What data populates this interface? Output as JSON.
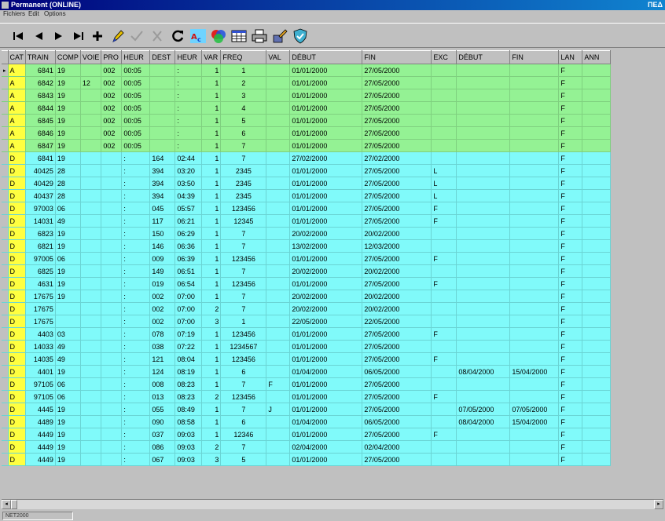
{
  "window": {
    "title": "Permanent (ONLINE)",
    "corner": "ΠΕΔ"
  },
  "menu": [
    {
      "id": "fichiers",
      "label": "Fichiers"
    },
    {
      "id": "edit",
      "label": "Edit"
    },
    {
      "id": "options",
      "label": "Options"
    }
  ],
  "toolbar": [
    {
      "name": "first-record-icon",
      "enabled": true
    },
    {
      "name": "previous-record-icon",
      "enabled": true
    },
    {
      "name": "next-record-icon",
      "enabled": true
    },
    {
      "name": "last-record-icon",
      "enabled": true
    },
    {
      "name": "add-record-icon",
      "enabled": true
    },
    {
      "name": "edit-pencil-icon",
      "enabled": true
    },
    {
      "name": "confirm-check-icon",
      "enabled": false
    },
    {
      "name": "cancel-x-icon",
      "enabled": false
    },
    {
      "name": "refresh-icon",
      "enabled": true
    },
    {
      "name": "spellcheck-abc-icon",
      "enabled": true
    },
    {
      "name": "color-palette-icon",
      "enabled": true
    },
    {
      "name": "grid-table-icon",
      "enabled": true
    },
    {
      "name": "print-icon",
      "enabled": true
    },
    {
      "name": "brush-icon",
      "enabled": true
    },
    {
      "name": "shield-icon",
      "enabled": true
    }
  ],
  "columns": [
    "CAT",
    "TRAIN",
    "COMP",
    "VOIE",
    "PRO",
    "HEUR",
    "DEST",
    "HEUR",
    "VAR",
    "FREQ",
    "VAL",
    "DÉBUT",
    "FIN",
    "EXC",
    "DÉBUT",
    "FIN",
    "LAN",
    "ANN"
  ],
  "current_row_marker": "▸",
  "colors": {
    "green_row": "#94f294",
    "cyan_row": "#80fafa",
    "cat_cell": "#ffff40",
    "title_bar": "#00007b"
  },
  "rows": [
    [
      "A",
      "6841",
      "19",
      "",
      "002",
      "00:05",
      "",
      ":",
      "1",
      "1",
      "",
      "01/01/2000",
      "27/05/2000",
      "",
      "",
      "",
      "F",
      ""
    ],
    [
      "A",
      "6842",
      "19",
      "12",
      "002",
      "00:05",
      "",
      ":",
      "1",
      "2",
      "",
      "01/01/2000",
      "27/05/2000",
      "",
      "",
      "",
      "F",
      ""
    ],
    [
      "A",
      "6843",
      "19",
      "",
      "002",
      "00:05",
      "",
      ":",
      "1",
      "3",
      "",
      "01/01/2000",
      "27/05/2000",
      "",
      "",
      "",
      "F",
      ""
    ],
    [
      "A",
      "6844",
      "19",
      "",
      "002",
      "00:05",
      "",
      ":",
      "1",
      "4",
      "",
      "01/01/2000",
      "27/05/2000",
      "",
      "",
      "",
      "F",
      ""
    ],
    [
      "A",
      "6845",
      "19",
      "",
      "002",
      "00:05",
      "",
      ":",
      "1",
      "5",
      "",
      "01/01/2000",
      "27/05/2000",
      "",
      "",
      "",
      "F",
      ""
    ],
    [
      "A",
      "6846",
      "19",
      "",
      "002",
      "00:05",
      "",
      ":",
      "1",
      "6",
      "",
      "01/01/2000",
      "27/05/2000",
      "",
      "",
      "",
      "F",
      ""
    ],
    [
      "A",
      "6847",
      "19",
      "",
      "002",
      "00:05",
      "",
      ":",
      "1",
      "7",
      "",
      "01/01/2000",
      "27/05/2000",
      "",
      "",
      "",
      "F",
      ""
    ],
    [
      "D",
      "6841",
      "19",
      "",
      "",
      ":",
      "164",
      "02:44",
      "1",
      "7",
      "",
      "27/02/2000",
      "27/02/2000",
      "",
      "",
      "",
      "F",
      ""
    ],
    [
      "D",
      "40425",
      "28",
      "",
      "",
      ":",
      "394",
      "03:20",
      "1",
      "2345",
      "",
      "01/01/2000",
      "27/05/2000",
      "L",
      "",
      "",
      "F",
      ""
    ],
    [
      "D",
      "40429",
      "28",
      "",
      "",
      ":",
      "394",
      "03:50",
      "1",
      "2345",
      "",
      "01/01/2000",
      "27/05/2000",
      "L",
      "",
      "",
      "F",
      ""
    ],
    [
      "D",
      "40437",
      "28",
      "",
      "",
      ":",
      "394",
      "04:39",
      "1",
      "2345",
      "",
      "01/01/2000",
      "27/05/2000",
      "L",
      "",
      "",
      "F",
      ""
    ],
    [
      "D",
      "97003",
      "06",
      "",
      "",
      ":",
      "045",
      "05:57",
      "1",
      "123456",
      "",
      "01/01/2000",
      "27/05/2000",
      "F",
      "",
      "",
      "F",
      ""
    ],
    [
      "D",
      "14031",
      "49",
      "",
      "",
      ":",
      "117",
      "06:21",
      "1",
      "12345",
      "",
      "01/01/2000",
      "27/05/2000",
      "F",
      "",
      "",
      "F",
      ""
    ],
    [
      "D",
      "6823",
      "19",
      "",
      "",
      ":",
      "150",
      "06:29",
      "1",
      "7",
      "",
      "20/02/2000",
      "20/02/2000",
      "",
      "",
      "",
      "F",
      ""
    ],
    [
      "D",
      "6821",
      "19",
      "",
      "",
      ":",
      "146",
      "06:36",
      "1",
      "7",
      "",
      "13/02/2000",
      "12/03/2000",
      "",
      "",
      "",
      "F",
      ""
    ],
    [
      "D",
      "97005",
      "06",
      "",
      "",
      ":",
      "009",
      "06:39",
      "1",
      "123456",
      "",
      "01/01/2000",
      "27/05/2000",
      "F",
      "",
      "",
      "F",
      ""
    ],
    [
      "D",
      "6825",
      "19",
      "",
      "",
      ":",
      "149",
      "06:51",
      "1",
      "7",
      "",
      "20/02/2000",
      "20/02/2000",
      "",
      "",
      "",
      "F",
      ""
    ],
    [
      "D",
      "4631",
      "19",
      "",
      "",
      ":",
      "019",
      "06:54",
      "1",
      "123456",
      "",
      "01/01/2000",
      "27/05/2000",
      "F",
      "",
      "",
      "F",
      ""
    ],
    [
      "D",
      "17675",
      "19",
      "",
      "",
      ":",
      "002",
      "07:00",
      "1",
      "7",
      "",
      "20/02/2000",
      "20/02/2000",
      "",
      "",
      "",
      "F",
      ""
    ],
    [
      "D",
      "17675",
      "",
      "",
      "",
      ":",
      "002",
      "07:00",
      "2",
      "7",
      "",
      "20/02/2000",
      "20/02/2000",
      "",
      "",
      "",
      "F",
      ""
    ],
    [
      "D",
      "17675",
      "",
      "",
      "",
      ":",
      "002",
      "07:00",
      "3",
      "1",
      "",
      "22/05/2000",
      "22/05/2000",
      "",
      "",
      "",
      "F",
      ""
    ],
    [
      "D",
      "4403",
      "03",
      "",
      "",
      ":",
      "078",
      "07:19",
      "1",
      "123456",
      "",
      "01/01/2000",
      "27/05/2000",
      "F",
      "",
      "",
      "F",
      ""
    ],
    [
      "D",
      "14033",
      "49",
      "",
      "",
      ":",
      "038",
      "07:22",
      "1",
      "1234567",
      "",
      "01/01/2000",
      "27/05/2000",
      "",
      "",
      "",
      "F",
      ""
    ],
    [
      "D",
      "14035",
      "49",
      "",
      "",
      ":",
      "121",
      "08:04",
      "1",
      "123456",
      "",
      "01/01/2000",
      "27/05/2000",
      "F",
      "",
      "",
      "F",
      ""
    ],
    [
      "D",
      "4401",
      "19",
      "",
      "",
      ":",
      "124",
      "08:19",
      "1",
      "6",
      "",
      "01/04/2000",
      "06/05/2000",
      "",
      "08/04/2000",
      "15/04/2000",
      "F",
      ""
    ],
    [
      "D",
      "97105",
      "06",
      "",
      "",
      ":",
      "008",
      "08:23",
      "1",
      "7",
      "F",
      "01/01/2000",
      "27/05/2000",
      "",
      "",
      "",
      "F",
      ""
    ],
    [
      "D",
      "97105",
      "06",
      "",
      "",
      ":",
      "013",
      "08:23",
      "2",
      "123456",
      "",
      "01/01/2000",
      "27/05/2000",
      "F",
      "",
      "",
      "F",
      ""
    ],
    [
      "D",
      "4445",
      "19",
      "",
      "",
      ":",
      "055",
      "08:49",
      "1",
      "7",
      "J",
      "01/01/2000",
      "27/05/2000",
      "",
      "07/05/2000",
      "07/05/2000",
      "F",
      ""
    ],
    [
      "D",
      "4489",
      "19",
      "",
      "",
      ":",
      "090",
      "08:58",
      "1",
      "6",
      "",
      "01/04/2000",
      "06/05/2000",
      "",
      "08/04/2000",
      "15/04/2000",
      "F",
      ""
    ],
    [
      "D",
      "4449",
      "19",
      "",
      "",
      ":",
      "037",
      "09:03",
      "1",
      "12346",
      "",
      "01/01/2000",
      "27/05/2000",
      "F",
      "",
      "",
      "F",
      ""
    ],
    [
      "D",
      "4449",
      "19",
      "",
      "",
      ":",
      "086",
      "09:03",
      "2",
      "7",
      "",
      "02/04/2000",
      "02/04/2000",
      "",
      "",
      "",
      "F",
      ""
    ],
    [
      "D",
      "4449",
      "19",
      "",
      "",
      ":",
      "067",
      "09:03",
      "3",
      "5",
      "",
      "01/01/2000",
      "27/05/2000",
      "",
      "",
      "",
      "F",
      ""
    ]
  ],
  "status": {
    "pane1": "NET2000"
  }
}
